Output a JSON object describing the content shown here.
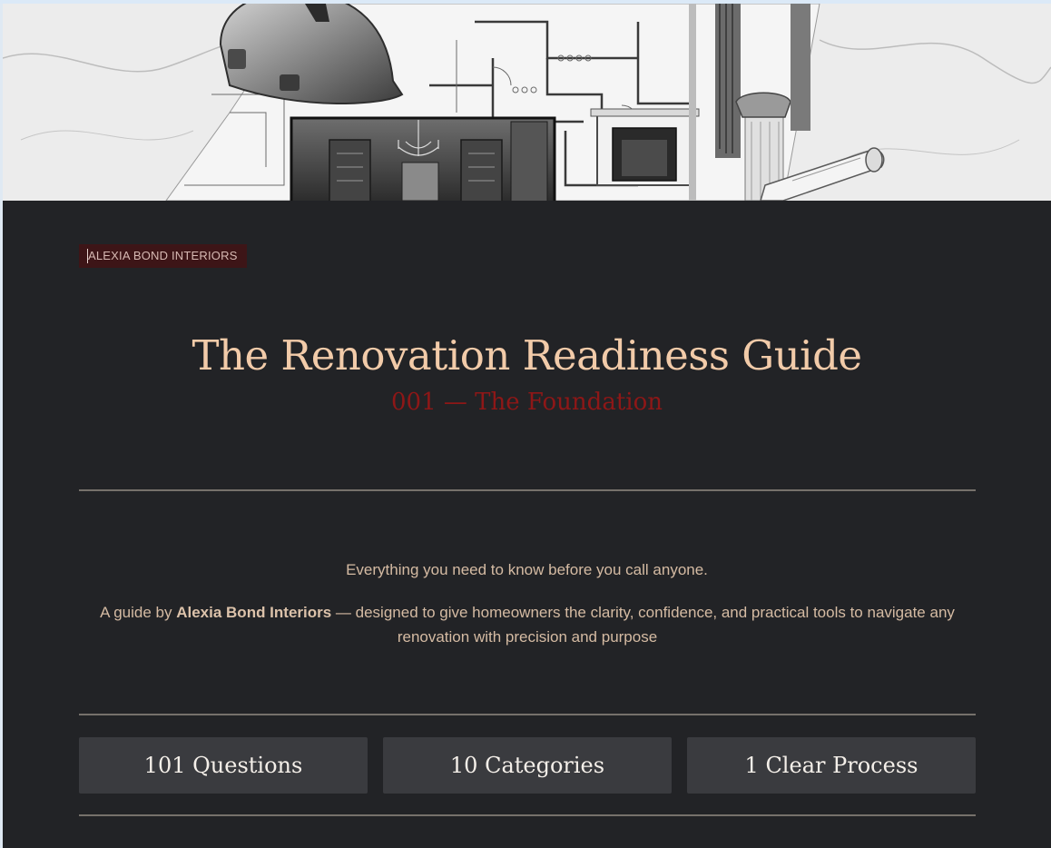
{
  "brand_tag": "ALEXIA BOND INTERIORS",
  "title": "The Renovation Readiness Guide",
  "subtitle": "001 — The Foundation",
  "tagline": "Everything you need to know before you call anyone.",
  "intro": {
    "prefix": "A guide by ",
    "brand": "Alexia Bond Interiors",
    "suffix": " — designed to give homeowners the clarity, confidence, and practical tools to navigate any renovation with precision and purpose"
  },
  "stats": [
    {
      "label": "101 Questions"
    },
    {
      "label": "10 Categories"
    },
    {
      "label": "1 Clear Process"
    }
  ],
  "colors": {
    "panel_background": "#222326",
    "title": "#f2cba9",
    "subtitle": "#8e1717",
    "brand_tag_background": "#3d1517",
    "stat_card_background": "#3a3b3f",
    "body_text": "#d5bba3"
  },
  "hero_image": {
    "icons": [
      "hard-hat-icon",
      "blueprint-icon",
      "chandelier-icon",
      "fireplace-icon",
      "column-icon",
      "rolled-plans-icon"
    ]
  }
}
